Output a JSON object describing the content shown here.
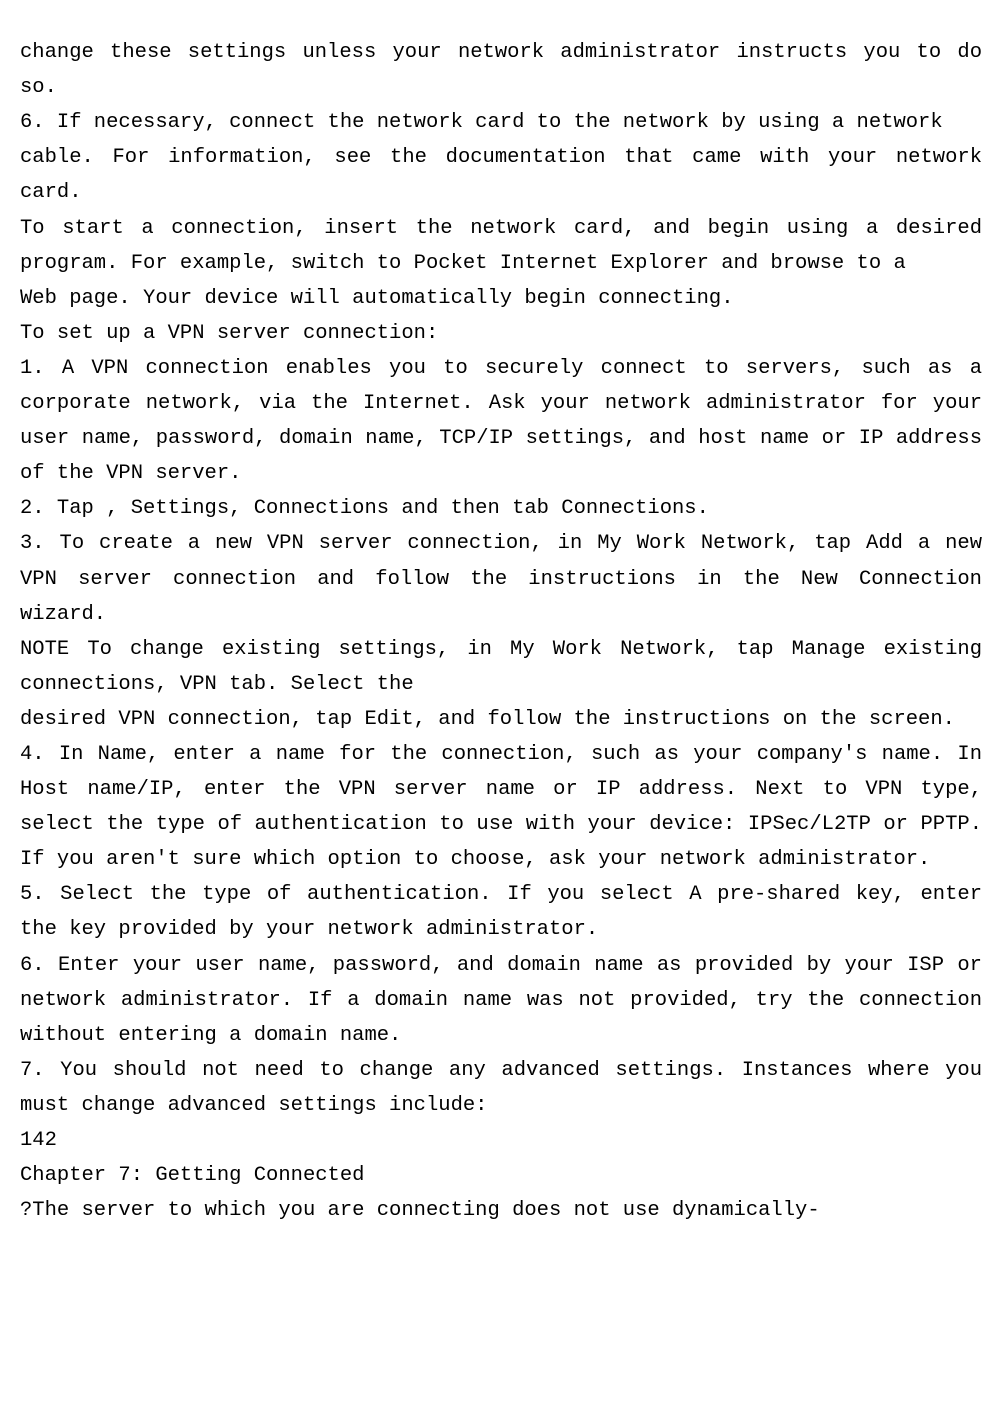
{
  "document": {
    "lines": [
      "change these settings unless your network administrator instructs you to do so.",
      "6. If necessary, connect the network card to the network by using a network",
      "cable. For information, see the documentation that came with your network card.",
      "To start a connection, insert the network card, and begin using a desired program. For example, switch to Pocket Internet Explorer and browse to a",
      "Web page. Your device will automatically begin connecting.",
      "To set up a VPN server connection:",
      "1. A VPN connection enables you to securely connect to servers, such as a corporate network, via the Internet. Ask your network administrator for your user name, password, domain name, TCP/IP settings, and host name or IP address of the VPN server.",
      "2. Tap , Settings, Connections and then tab Connections.",
      "3. To create a new VPN server connection, in My Work Network, tap Add a new VPN server connection and follow the instructions in the New Connection wizard.",
      "NOTE To change existing settings, in My Work Network, tap Manage existing connections, VPN tab. Select the",
      "desired VPN connection, tap Edit, and follow the instructions on the screen.",
      "4. In Name, enter a name for the connection, such as your company's name. In Host name/IP, enter the VPN server name or IP address. Next to VPN type, select the type of authentication to use with your device: IPSec/L2TP or PPTP. If you aren't sure which option to choose, ask your network administrator.",
      "5. Select the type of authentication. If you select A pre-shared key, enter the key provided by your network administrator.",
      "6. Enter your user name, password, and domain name as provided by your ISP or network administrator. If a domain name was not provided, try the connection without entering a domain name.",
      "7. You should not need to change any advanced settings. Instances where you must change advanced settings include:",
      "142",
      "Chapter 7: Getting Connected",
      "?The server to which you are connecting does not use dynamically-"
    ]
  }
}
